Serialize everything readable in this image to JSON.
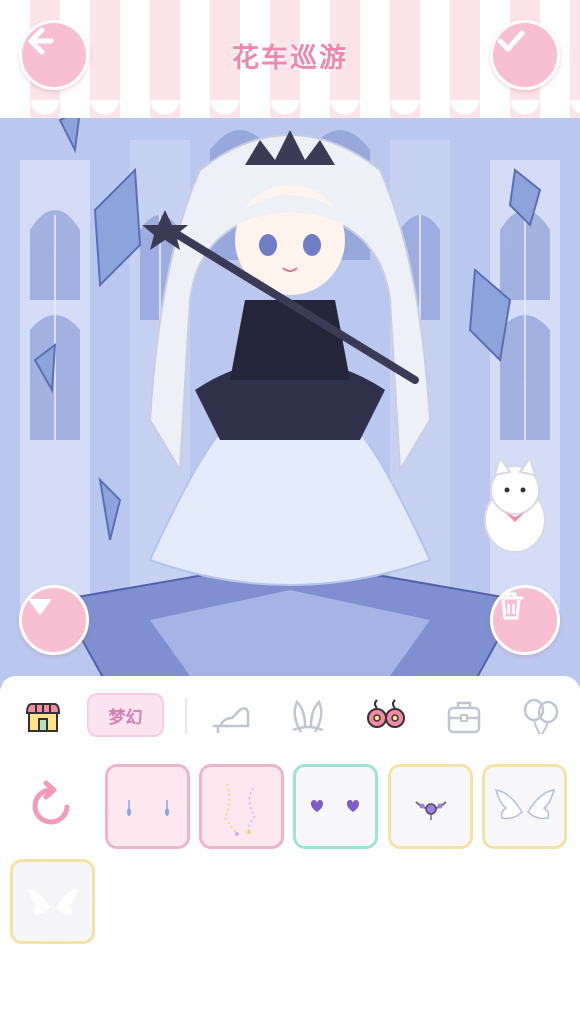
{
  "header": {
    "title": "花车巡游"
  },
  "buttons": {
    "back": "back-arrow-icon",
    "confirm": "checkmark-icon",
    "collapse": "triangle-down-icon",
    "delete": "trash-icon"
  },
  "categories": {
    "active_tab_label": "梦幻",
    "items": [
      {
        "name": "shop-icon"
      },
      {
        "name": "high-heel-shoe-icon"
      },
      {
        "name": "bunny-ears-icon"
      },
      {
        "name": "flower-earrings-icon",
        "selected": true
      },
      {
        "name": "bag-icon"
      },
      {
        "name": "balloons-icon"
      }
    ]
  },
  "items": [
    {
      "name": "drop-earrings",
      "border": "#eeb5c8",
      "bg": "#fde8f0"
    },
    {
      "name": "sparkle-chain-earrings",
      "border": "#eeb5c8",
      "bg": "#fde8f0"
    },
    {
      "name": "purple-heart-studs",
      "border": "#9fe3d3",
      "bg": "#f7f7f9"
    },
    {
      "name": "jewel-necklace",
      "border": "#f5e2a6",
      "bg": "#f7f7f9"
    },
    {
      "name": "angel-wings",
      "border": "#f5e2a6",
      "bg": "#f7f7f9"
    },
    {
      "name": "white-wings",
      "border": "#f5e2a6",
      "bg": "#f7f7f9"
    }
  ],
  "colors": {
    "accent_pink": "#f8bfd2",
    "title_pink": "#f088ae",
    "refresh_pink": "#f29ab7"
  }
}
